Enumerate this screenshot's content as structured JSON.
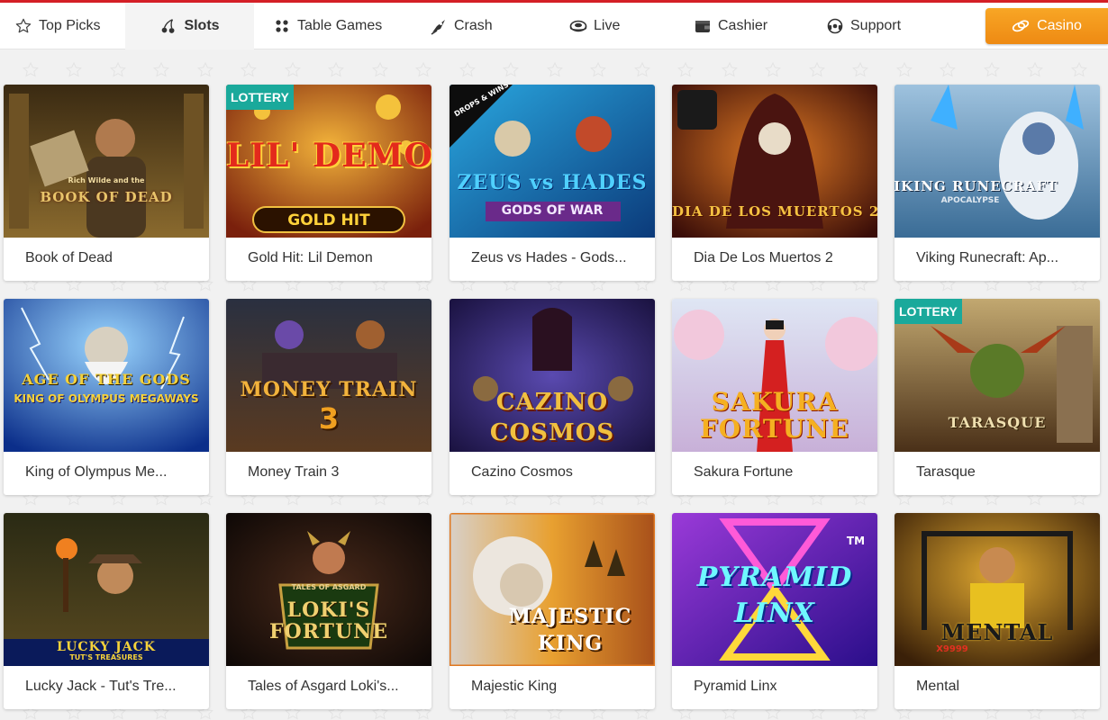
{
  "nav": {
    "items": [
      {
        "label": "Top Picks",
        "icon": "star-icon"
      },
      {
        "label": "Slots",
        "icon": "cherries-icon"
      },
      {
        "label": "Table Games",
        "icon": "chips-icon"
      },
      {
        "label": "Crash",
        "icon": "rocket-icon"
      },
      {
        "label": "Live",
        "icon": "roulette-icon"
      },
      {
        "label": "Cashier",
        "icon": "wallet-icon"
      },
      {
        "label": "Support",
        "icon": "headset-icon"
      }
    ],
    "active": "Slots",
    "casino_button": "Casino"
  },
  "colors": {
    "accent_red": "#d41f26",
    "casino_orange": "#f39a1c",
    "lottery_badge": "#1aa99b"
  },
  "games": [
    {
      "title": "Book of Dead",
      "art": {
        "logo": "BOOK OF DEAD",
        "sub": "Rich Wilde and the",
        "theme": "#5b4320"
      }
    },
    {
      "title": "Gold Hit: Lil Demon",
      "art": {
        "logo": "LIL' DEMON",
        "sub": "GOLD HIT",
        "badge": "LOTTERY",
        "theme": "#8a2a0f"
      }
    },
    {
      "title": "Zeus vs Hades - Gods...",
      "art": {
        "logo": "ZEUS vs HADES",
        "sub": "GODS OF WAR",
        "badge": "DROPS & WINS",
        "theme": "#1e5fa8"
      }
    },
    {
      "title": "Dia De Los Muertos 2",
      "art": {
        "logo": "DIA DE LOS MUERTOS 2",
        "theme": "#6b1d0f"
      }
    },
    {
      "title": "Viking Runecraft: Ap...",
      "art": {
        "logo": "VIKING RUNECRAFT",
        "sub": "APOCALYPSE",
        "theme": "#3f6c92"
      }
    },
    {
      "title": "King of Olympus Me...",
      "art": {
        "logo": "AGE OF THE GODS",
        "sub": "KING OF OLYMPUS MEGAWAYS",
        "theme": "#1b56b8"
      }
    },
    {
      "title": "Money Train 3",
      "art": {
        "logo": "MONEY TRAIN",
        "sub": "3",
        "theme": "#3a2d2a"
      }
    },
    {
      "title": "Cazino Cosmos",
      "art": {
        "logo": "CAZINO COSMOS",
        "theme": "#3a2a6e"
      }
    },
    {
      "title": "Sakura Fortune",
      "art": {
        "logo": "SAKURA FORTUNE",
        "theme": "#c9d2e6"
      }
    },
    {
      "title": "Tarasque",
      "art": {
        "logo": "TARASQUE",
        "badge": "LOTTERY",
        "theme": "#6a5030"
      }
    },
    {
      "title": "Lucky Jack - Tut's Tre...",
      "art": {
        "logo": "LUCKY JACK",
        "sub": "TUT'S TREASURES",
        "theme": "#3a3418"
      }
    },
    {
      "title": "Tales of Asgard Loki's...",
      "art": {
        "logo": "LOKI'S FORTUNE",
        "sub": "TALES OF ASGARD",
        "theme": "#2a1a14"
      }
    },
    {
      "title": "Majestic King",
      "art": {
        "logo": "MAJESTIC KING",
        "theme": "#c7841f"
      }
    },
    {
      "title": "Pyramid Linx",
      "art": {
        "logo": "PYRAMID LINX",
        "sub": "TM",
        "theme": "#5a21c9"
      }
    },
    {
      "title": "Mental",
      "art": {
        "logo": "MENTAL",
        "sub": "X9999",
        "theme": "#b8821a"
      }
    }
  ]
}
